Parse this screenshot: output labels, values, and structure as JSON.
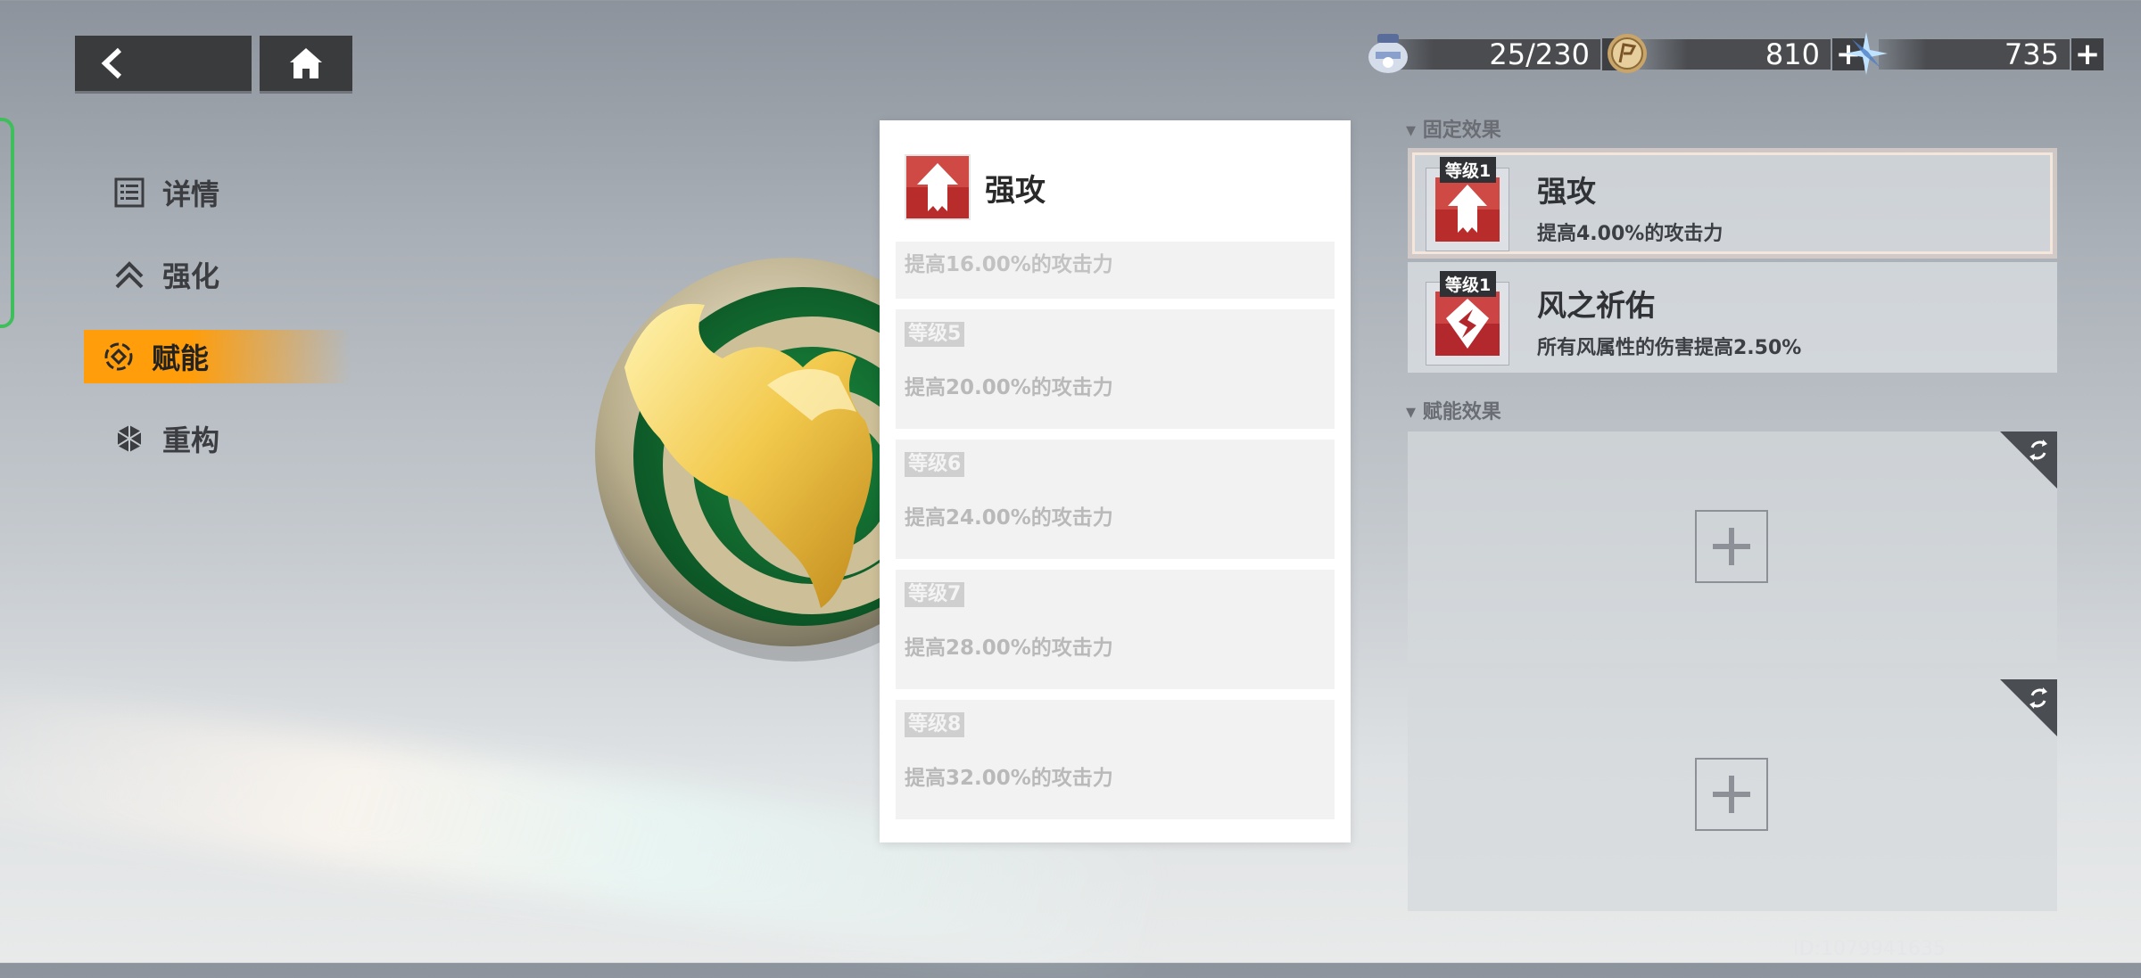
{
  "nav": {
    "back_icon": "back-arrow-icon",
    "home_icon": "home-icon"
  },
  "side_menu": {
    "items": [
      {
        "label": "详情",
        "icon": "details-list-icon",
        "active": false
      },
      {
        "label": "强化",
        "icon": "upgrade-chevron-icon",
        "active": false
      },
      {
        "label": "赋能",
        "icon": "empower-icon",
        "active": true
      },
      {
        "label": "重构",
        "icon": "rebuild-icon",
        "active": false
      }
    ]
  },
  "resources": [
    {
      "name": "stamina",
      "icon": "stamina-icon",
      "value": "25/230"
    },
    {
      "name": "gold",
      "icon": "coin-icon",
      "value": "810"
    },
    {
      "name": "crystal",
      "icon": "crystal-icon",
      "value": "735"
    }
  ],
  "detail_panel": {
    "title": "强攻",
    "partial_text": "提高16.00%的攻击力",
    "levels": [
      {
        "tag": "等级5",
        "text": "提高20.00%的攻击力"
      },
      {
        "tag": "等级6",
        "text": "提高24.00%的攻击力"
      },
      {
        "tag": "等级7",
        "text": "提高28.00%的攻击力"
      },
      {
        "tag": "等级8",
        "text": "提高32.00%的攻击力"
      }
    ]
  },
  "fixed_effects": {
    "label": "▾ 固定效果",
    "items": [
      {
        "level": "等级1",
        "name": "强攻",
        "desc": "提高4.00%的攻击力",
        "selected": true
      },
      {
        "level": "等级1",
        "name": "风之祈佑",
        "desc": "所有风属性的伤害提高2.50%",
        "selected": false
      }
    ]
  },
  "empower_effects": {
    "label": "▾ 赋能效果",
    "slots": [
      {
        "icon": "add-icon"
      },
      {
        "icon": "add-icon"
      }
    ]
  },
  "footer": {
    "id_text": "ID:1079941635"
  },
  "colors": {
    "accent": "#ff9d0a",
    "green_edge": "#3fbf5b",
    "panel": "#ffffff"
  }
}
